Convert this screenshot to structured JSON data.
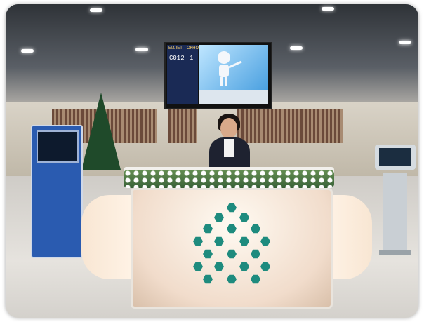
{
  "display": {
    "header_left": "БИЛЕТ",
    "header_right": "ОКНО",
    "ticket": "C012",
    "window": "1"
  },
  "logo": {
    "shape": "hexagon-triangle",
    "color": "#1e8b7e"
  }
}
